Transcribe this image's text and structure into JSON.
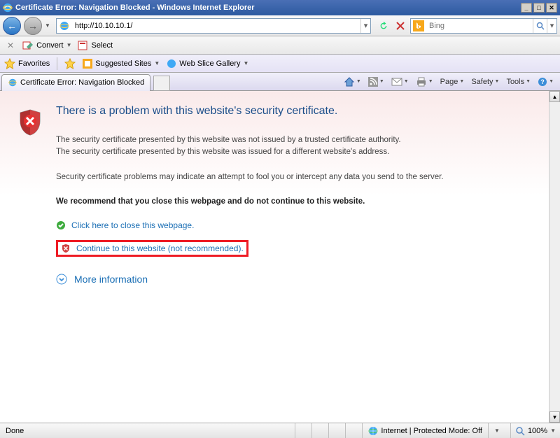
{
  "window": {
    "title": "Certificate Error: Navigation Blocked - Windows Internet Explorer"
  },
  "nav": {
    "url": "http://10.10.10.1/",
    "search_placeholder": "Bing"
  },
  "convert_bar": {
    "convert_label": "Convert",
    "select_label": "Select"
  },
  "favbar": {
    "favorites_label": "Favorites",
    "suggested_label": "Suggested Sites",
    "webslice_label": "Web Slice Gallery"
  },
  "tab": {
    "label": "Certificate Error: Navigation Blocked"
  },
  "tabbar_tools": {
    "page": "Page",
    "safety": "Safety",
    "tools": "Tools"
  },
  "cert": {
    "title": "There is a problem with this website's security certificate.",
    "line1": "The security certificate presented by this website was not issued by a trusted certificate authority.",
    "line2": "The security certificate presented by this website was issued for a different website's address.",
    "line3": "Security certificate problems may indicate an attempt to fool you or intercept any data you send to the server.",
    "recommend": "We recommend that you close this webpage and do not continue to this website.",
    "close_link": "Click here to close this webpage.",
    "continue_link": "Continue to this website (not recommended).",
    "more_info": "More information"
  },
  "status": {
    "done": "Done",
    "zone": "Internet | Protected Mode: Off",
    "zoom": "100%"
  }
}
